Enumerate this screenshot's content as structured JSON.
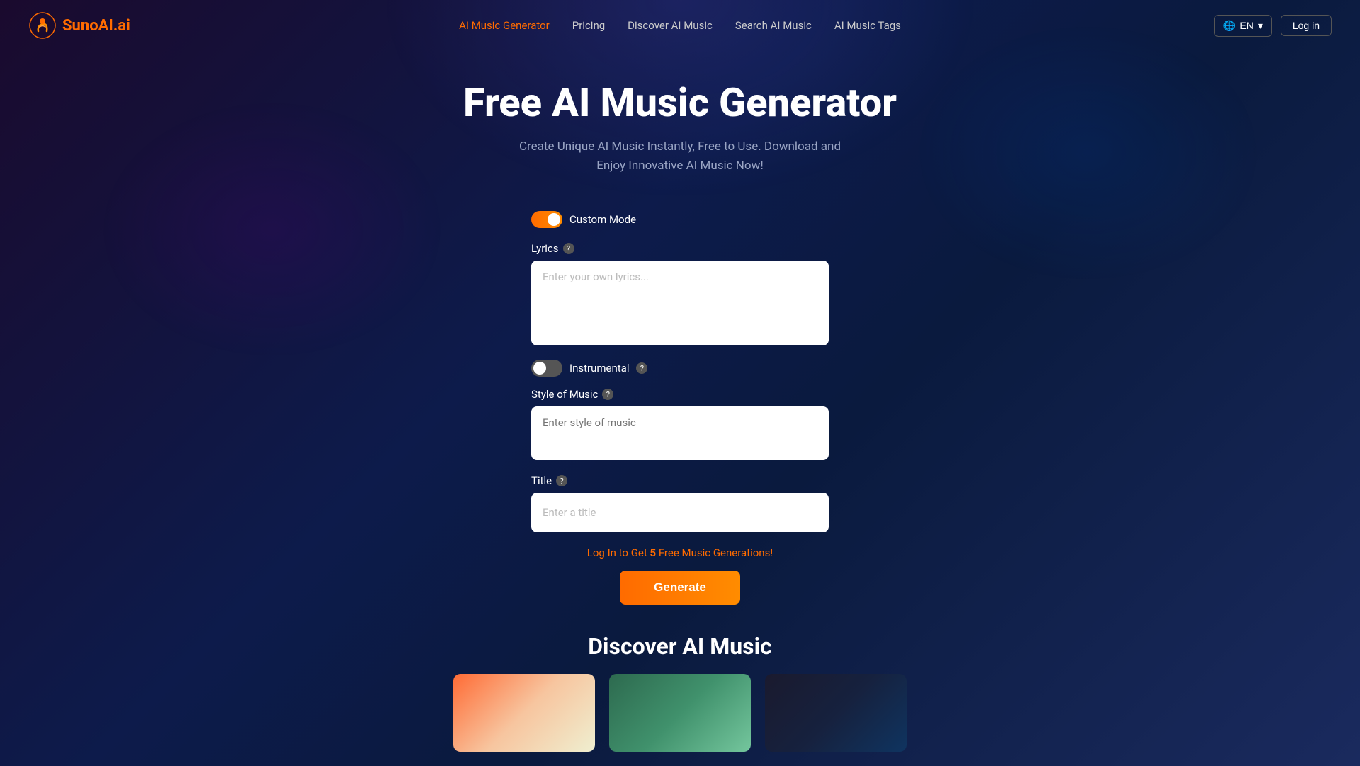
{
  "brand": {
    "name": "SunoAI.ai",
    "logo_alt": "SunoAI logo"
  },
  "navbar": {
    "links": [
      {
        "label": "AI Music Generator",
        "active": true
      },
      {
        "label": "Pricing",
        "active": false
      },
      {
        "label": "Discover AI Music",
        "active": false
      },
      {
        "label": "Search AI Music",
        "active": false
      },
      {
        "label": "AI Music Tags",
        "active": false
      }
    ],
    "lang_button": "EN",
    "login_button": "Log in"
  },
  "hero": {
    "title": "Free AI Music Generator",
    "subtitle": "Create Unique AI Music Instantly, Free to Use. Download and\nEnjoy Innovative AI Music Now!"
  },
  "form": {
    "custom_mode_label": "Custom Mode",
    "custom_mode_on": true,
    "lyrics_label": "Lyrics",
    "lyrics_placeholder": "Enter your own lyrics...",
    "instrumental_label": "Instrumental",
    "instrumental_on": false,
    "style_label": "Style of Music",
    "style_placeholder": "Enter style of music",
    "title_label": "Title",
    "title_placeholder": "Enter a title",
    "login_promo": "Log In to Get 5 Free Music Generations!",
    "login_promo_highlight": "5",
    "generate_button": "Generate"
  },
  "discover": {
    "title": "Discover AI Music"
  }
}
